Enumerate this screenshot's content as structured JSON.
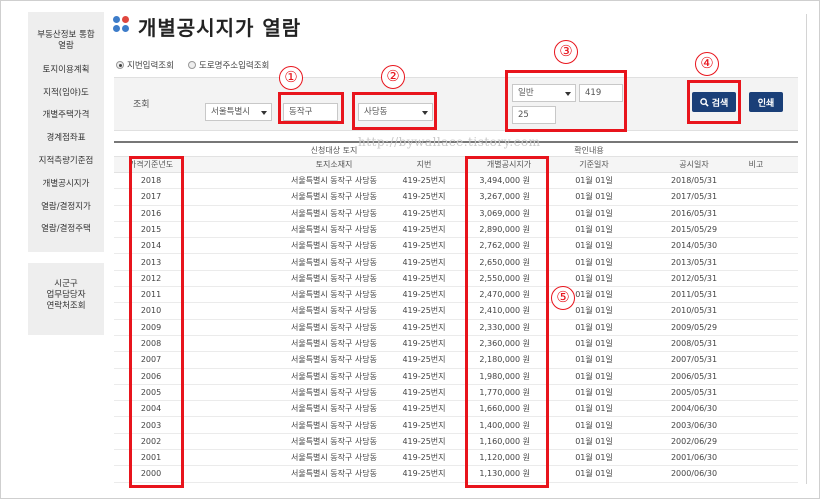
{
  "page": {
    "title": "개별공시지가 열람"
  },
  "sidebar": {
    "items": [
      {
        "label": "부동산정보 통합"
      },
      {
        "label": "열람"
      },
      {
        "label": "토지이용계획"
      },
      {
        "label": "지적(임야)도"
      },
      {
        "label": "개별주택가격"
      },
      {
        "label": "경계점좌표"
      },
      {
        "label": "지적측량기준점"
      },
      {
        "label": "개별공시지가"
      },
      {
        "label": "열람/결정지가"
      },
      {
        "label": "열람/결정주택"
      }
    ],
    "contact": "시군구\n업무담당자\n연락처조회"
  },
  "search_mode": {
    "options": [
      {
        "label": "지번입력조회",
        "selected": true
      },
      {
        "label": "도로명주소입력조회",
        "selected": false
      }
    ]
  },
  "search": {
    "label": "조회",
    "sido": "서울특별시",
    "sigungu": "동작구",
    "dong": "사당동",
    "land_type": "일반",
    "bonbun": "419",
    "bubun": "25",
    "search_button": "검색",
    "print_button": "인쇄"
  },
  "annotations": [
    "①",
    "②",
    "③",
    "④",
    "⑤"
  ],
  "watermark": "http://bywallace.tistory.com",
  "table": {
    "group_headers": {
      "target": "신청대상 토지",
      "confirm": "확인내용"
    },
    "columns": [
      "가격기준년도",
      "토지소재지",
      "지번",
      "개별공시지가",
      "기준일자",
      "공시일자",
      "비고"
    ],
    "rows": [
      {
        "year": "2018",
        "location": "서울특별시 동작구 사당동",
        "jibun": "419-25번지",
        "price": "3,494,000 원",
        "base_date": "01월 01일",
        "pub_date": "2018/05/31",
        "note": ""
      },
      {
        "year": "2017",
        "location": "서울특별시 동작구 사당동",
        "jibun": "419-25번지",
        "price": "3,267,000 원",
        "base_date": "01월 01일",
        "pub_date": "2017/05/31",
        "note": ""
      },
      {
        "year": "2016",
        "location": "서울특별시 동작구 사당동",
        "jibun": "419-25번지",
        "price": "3,069,000 원",
        "base_date": "01월 01일",
        "pub_date": "2016/05/31",
        "note": ""
      },
      {
        "year": "2015",
        "location": "서울특별시 동작구 사당동",
        "jibun": "419-25번지",
        "price": "2,890,000 원",
        "base_date": "01월 01일",
        "pub_date": "2015/05/29",
        "note": ""
      },
      {
        "year": "2014",
        "location": "서울특별시 동작구 사당동",
        "jibun": "419-25번지",
        "price": "2,762,000 원",
        "base_date": "01월 01일",
        "pub_date": "2014/05/30",
        "note": ""
      },
      {
        "year": "2013",
        "location": "서울특별시 동작구 사당동",
        "jibun": "419-25번지",
        "price": "2,650,000 원",
        "base_date": "01월 01일",
        "pub_date": "2013/05/31",
        "note": ""
      },
      {
        "year": "2012",
        "location": "서울특별시 동작구 사당동",
        "jibun": "419-25번지",
        "price": "2,550,000 원",
        "base_date": "01월 01일",
        "pub_date": "2012/05/31",
        "note": ""
      },
      {
        "year": "2011",
        "location": "서울특별시 동작구 사당동",
        "jibun": "419-25번지",
        "price": "2,470,000 원",
        "base_date": "01월 01일",
        "pub_date": "2011/05/31",
        "note": ""
      },
      {
        "year": "2010",
        "location": "서울특별시 동작구 사당동",
        "jibun": "419-25번지",
        "price": "2,410,000 원",
        "base_date": "01월 01일",
        "pub_date": "2010/05/31",
        "note": ""
      },
      {
        "year": "2009",
        "location": "서울특별시 동작구 사당동",
        "jibun": "419-25번지",
        "price": "2,330,000 원",
        "base_date": "01월 01일",
        "pub_date": "2009/05/29",
        "note": ""
      },
      {
        "year": "2008",
        "location": "서울특별시 동작구 사당동",
        "jibun": "419-25번지",
        "price": "2,360,000 원",
        "base_date": "01월 01일",
        "pub_date": "2008/05/31",
        "note": ""
      },
      {
        "year": "2007",
        "location": "서울특별시 동작구 사당동",
        "jibun": "419-25번지",
        "price": "2,180,000 원",
        "base_date": "01월 01일",
        "pub_date": "2007/05/31",
        "note": ""
      },
      {
        "year": "2006",
        "location": "서울특별시 동작구 사당동",
        "jibun": "419-25번지",
        "price": "1,980,000 원",
        "base_date": "01월 01일",
        "pub_date": "2006/05/31",
        "note": ""
      },
      {
        "year": "2005",
        "location": "서울특별시 동작구 사당동",
        "jibun": "419-25번지",
        "price": "1,770,000 원",
        "base_date": "01월 01일",
        "pub_date": "2005/05/31",
        "note": ""
      },
      {
        "year": "2004",
        "location": "서울특별시 동작구 사당동",
        "jibun": "419-25번지",
        "price": "1,660,000 원",
        "base_date": "01월 01일",
        "pub_date": "2004/06/30",
        "note": ""
      },
      {
        "year": "2003",
        "location": "서울특별시 동작구 사당동",
        "jibun": "419-25번지",
        "price": "1,400,000 원",
        "base_date": "01월 01일",
        "pub_date": "2003/06/30",
        "note": ""
      },
      {
        "year": "2002",
        "location": "서울특별시 동작구 사당동",
        "jibun": "419-25번지",
        "price": "1,160,000 원",
        "base_date": "01월 01일",
        "pub_date": "2002/06/29",
        "note": ""
      },
      {
        "year": "2001",
        "location": "서울특별시 동작구 사당동",
        "jibun": "419-25번지",
        "price": "1,120,000 원",
        "base_date": "01월 01일",
        "pub_date": "2001/06/30",
        "note": ""
      },
      {
        "year": "2000",
        "location": "서울특별시 동작구 사당동",
        "jibun": "419-25번지",
        "price": "1,130,000 원",
        "base_date": "01월 01일",
        "pub_date": "2000/06/30",
        "note": ""
      }
    ]
  },
  "colors": {
    "brand_dot_blue": "#3d7cc9",
    "brand_dot_red": "#e0473e",
    "button": "#1a3f78",
    "annotation": "#e8141c"
  }
}
